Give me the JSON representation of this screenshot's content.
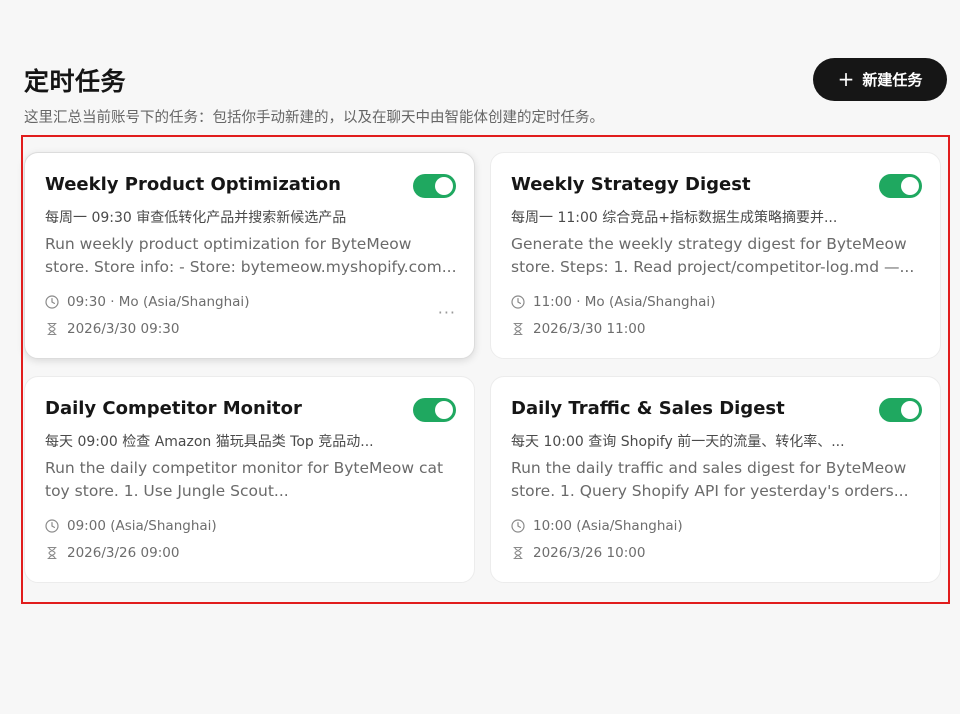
{
  "header": {
    "title": "定时任务",
    "subtitle": "这里汇总当前账号下的任务：包括你手动新建的，以及在聊天中由智能体创建的定时任务。",
    "new_task_label": "新建任务",
    "new_task_icon": "plus-icon"
  },
  "colors": {
    "toggle_on": "#1fa860",
    "highlight": "#e11d1d",
    "button_bg": "#161616"
  },
  "tasks": [
    {
      "title": "Weekly Product Optimization",
      "enabled": true,
      "schedule_summary": "每周一 09:30 审查低转化产品并搜索新候选产品",
      "description": "Run weekly product optimization for ByteMeow store. Store info: - Store: bytemeow.myshopify.com...",
      "time": "09:30 · Mo (Asia/Shanghai)",
      "next_run": "2026/3/30 09:30",
      "more": "···"
    },
    {
      "title": "Weekly Strategy Digest",
      "enabled": true,
      "schedule_summary": "每周一 11:00 综合竞品+指标数据生成策略摘要并...",
      "description": "Generate the weekly strategy digest for ByteMeow store. Steps: 1. Read project/competitor-log.md —...",
      "time": "11:00 · Mo (Asia/Shanghai)",
      "next_run": "2026/3/30 11:00"
    },
    {
      "title": "Daily Competitor Monitor",
      "enabled": true,
      "schedule_summary": "每天 09:00 检查 Amazon 猫玩具品类 Top 竞品动...",
      "description": "Run the daily competitor monitor for ByteMeow cat toy store. 1. Use Jungle Scout...",
      "time": "09:00 (Asia/Shanghai)",
      "next_run": "2026/3/26 09:00"
    },
    {
      "title": "Daily Traffic & Sales Digest",
      "enabled": true,
      "schedule_summary": "每天 10:00 查询 Shopify 前一天的流量、转化率、...",
      "description": "Run the daily traffic and sales digest for ByteMeow store. 1. Query Shopify API for yesterday's orders...",
      "time": "10:00 (Asia/Shanghai)",
      "next_run": "2026/3/26 10:00"
    }
  ]
}
